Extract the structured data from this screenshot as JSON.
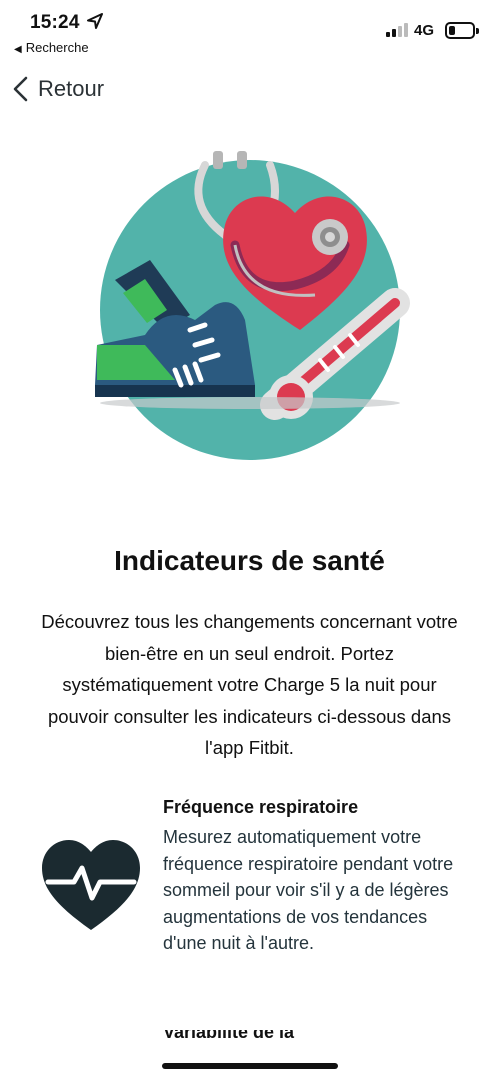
{
  "status_bar": {
    "time": "15:24",
    "back_app": "Recherche",
    "network": "4G",
    "icons": [
      "location-arrow-icon",
      "signal-icon",
      "battery-icon"
    ],
    "battery_level": 0.2
  },
  "nav": {
    "back_label": "Retour",
    "back_icon": "chevron-left-icon"
  },
  "hero": {
    "illustration": "health-illustration",
    "colors": {
      "circle": "#52b3aa",
      "heart": "#dc3a50",
      "shoe": "#2b5a80",
      "shoe_accent": "#3fba5a"
    }
  },
  "main": {
    "title": "Indicateurs de santé",
    "intro": "Découvrez tous les changements concernant votre bien-être en un seul endroit. Portez systématiquement votre Charge 5 la nuit pour pouvoir consulter les indicateurs ci-dessous dans l'app Fitbit."
  },
  "features": [
    {
      "icon": "heart-pulse-icon",
      "title": "Fréquence respiratoire",
      "description": "Mesurez automatiquement votre fréquence respiratoire pendant votre sommeil pour voir s'il y a de légères augmentations de vos tendances d'une nuit à l'autre."
    },
    {
      "title": "Variabilité de la fréquence"
    }
  ]
}
